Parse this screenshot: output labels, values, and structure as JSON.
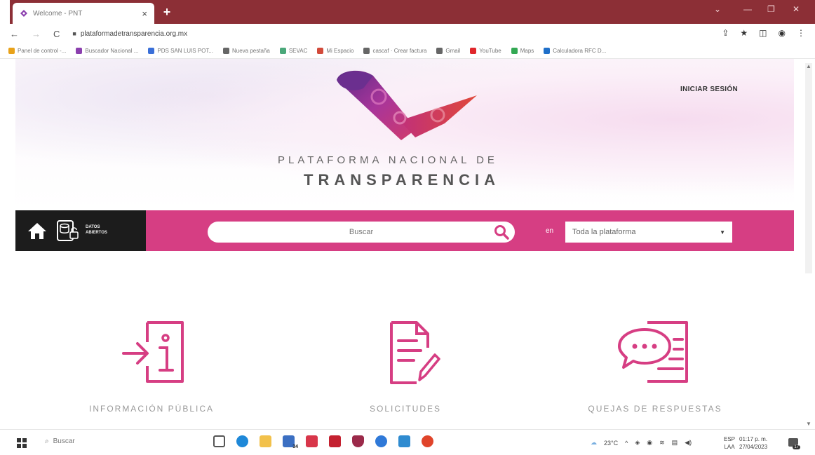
{
  "browser": {
    "tab_title": "Welcome - PNT",
    "tab_close": "×",
    "new_tab": "+",
    "url": "plataformadetransparencia.org.mx",
    "nav_back": "←",
    "nav_forward": "→",
    "nav_reload": "C",
    "bookmarks": [
      {
        "label": "Panel de control -...",
        "color": "#e8a21a"
      },
      {
        "label": "Buscador Nacional ...",
        "color": "#8b3fae"
      },
      {
        "label": "PDS SAN LUIS POT...",
        "color": "#3a6fd8"
      },
      {
        "label": "Nueva pestaña",
        "color": "#666666"
      },
      {
        "label": "SEVAC",
        "color": "#4aa87a"
      },
      {
        "label": "Mi Espacio",
        "color": "#d24a3a"
      },
      {
        "label": "cascaf · Crear factura",
        "color": "#666666"
      },
      {
        "label": "Gmail",
        "color": "#666666"
      },
      {
        "label": "YouTube",
        "color": "#e0262b"
      },
      {
        "label": "Maps",
        "color": "#33a853"
      },
      {
        "label": "Calculadora RFC D...",
        "color": "#1f6fc9"
      }
    ]
  },
  "header": {
    "login_label": "INICIAR SESIÓN",
    "brand_line1": "PLATAFORMA NACIONAL DE",
    "brand_line2": "TRANSPARENCIA"
  },
  "search": {
    "open_data_label_1": "DATOS",
    "open_data_label_2": "ABIERTOS",
    "placeholder": "Buscar",
    "en_label": "en",
    "scope_value": "Toda la plataforma"
  },
  "features": [
    {
      "label": "INFORMACIÓN PÚBLICA",
      "icon": "info-doc-icon"
    },
    {
      "label": "SOLICITUDES",
      "icon": "document-pen-icon"
    },
    {
      "label": "QUEJAS DE RESPUESTAS",
      "icon": "chat-doc-icon"
    }
  ],
  "taskbar": {
    "search_label": "Buscar",
    "mail_badge": "34",
    "temperature": "23°C",
    "lang_1": "ESP",
    "lang_2": "LAA",
    "time": "01:17 p. m.",
    "date": "27/04/2023",
    "notifications": "17"
  },
  "colors": {
    "accent": "#d63e83",
    "titlebar": "#8c2f36",
    "dark": "#1c1c1c"
  }
}
